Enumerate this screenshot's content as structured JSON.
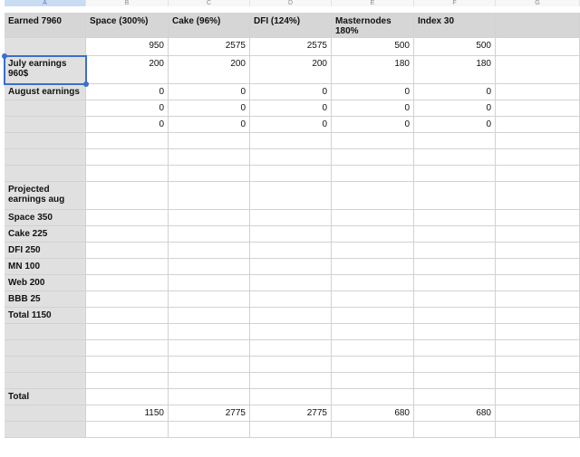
{
  "columns": [
    "A",
    "B",
    "C",
    "D",
    "E",
    "F",
    "G"
  ],
  "rows": [
    [
      "Earned 7960",
      "Space  (300%)",
      "Cake (96%)",
      "DFI (124%)",
      "Masternodes\n180%",
      "Index 30",
      ""
    ],
    [
      "",
      "950",
      "2575",
      "2575",
      "500",
      "500",
      ""
    ],
    [
      "July earnings\n960$",
      "200",
      "200",
      "200",
      "180",
      "180",
      ""
    ],
    [
      "August earnings",
      "0",
      "0",
      "0",
      "0",
      "0",
      ""
    ],
    [
      "",
      "0",
      "0",
      "0",
      "0",
      "0",
      ""
    ],
    [
      "",
      "0",
      "0",
      "0",
      "0",
      "0",
      ""
    ],
    [
      "",
      "",
      "",
      "",
      "",
      "",
      ""
    ],
    [
      "",
      "",
      "",
      "",
      "",
      "",
      ""
    ],
    [
      "",
      "",
      "",
      "",
      "",
      "",
      ""
    ],
    [
      "Projected\nearnings aug",
      "",
      "",
      "",
      "",
      "",
      ""
    ],
    [
      "Space 350",
      "",
      "",
      "",
      "",
      "",
      ""
    ],
    [
      "Cake 225",
      "",
      "",
      "",
      "",
      "",
      ""
    ],
    [
      "DFI 250",
      "",
      "",
      "",
      "",
      "",
      ""
    ],
    [
      "MN 100",
      "",
      "",
      "",
      "",
      "",
      ""
    ],
    [
      "Web 200",
      "",
      "",
      "",
      "",
      "",
      ""
    ],
    [
      "BBB 25",
      "",
      "",
      "",
      "",
      "",
      ""
    ],
    [
      "Total 1150",
      "",
      "",
      "",
      "",
      "",
      ""
    ],
    [
      "",
      "",
      "",
      "",
      "",
      "",
      ""
    ],
    [
      "",
      "",
      "",
      "",
      "",
      "",
      ""
    ],
    [
      "",
      "",
      "",
      "",
      "",
      "",
      ""
    ],
    [
      "",
      "",
      "",
      "",
      "",
      "",
      ""
    ],
    [
      "Total",
      "",
      "",
      "",
      "",
      "",
      ""
    ],
    [
      "",
      "1150",
      "2775",
      "2775",
      "680",
      "680",
      ""
    ],
    [
      "",
      "",
      "",
      "",
      "",
      "",
      ""
    ]
  ],
  "selected_cell": "A3",
  "colors": {
    "selection": "#3b6fc9",
    "header_bg": "#d6d6d6",
    "col_a_bg": "#e0e0e0"
  }
}
